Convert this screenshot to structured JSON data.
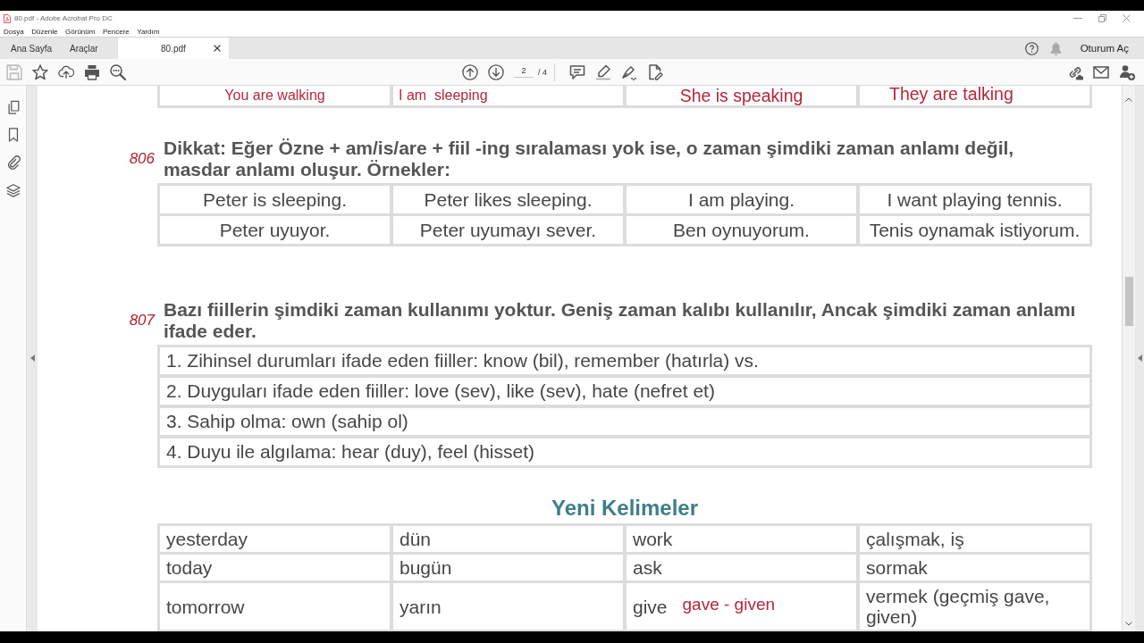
{
  "window": {
    "title": "80.pdf - Adobe Acrobat Pro DC"
  },
  "menu": [
    "Dosya",
    "Düzenle",
    "Görünüm",
    "Pencere",
    "Yardım"
  ],
  "tabs": [
    {
      "label": "Ana Sayfa",
      "selected": false,
      "closable": false
    },
    {
      "label": "Araçlar",
      "selected": false,
      "closable": false
    },
    {
      "label": "80.pdf",
      "selected": true,
      "closable": true
    }
  ],
  "account": {
    "label": "Oturum Aç"
  },
  "toolbar": {
    "save_disabled": true,
    "page": {
      "value": "2",
      "total": "/ 4"
    }
  },
  "document": {
    "top_row": [
      "You are walking",
      "I am  sleeping",
      "She is speaking",
      "They are talking"
    ],
    "sections": [
      {
        "number": "806",
        "heading": [
          "Dikkat: Eğer Özne + am/is/are + fiil -ing sıralaması yok ise, o zaman şimdiki zaman anlamı değil,",
          "masdar anlamı oluşur. Örnekler:"
        ],
        "kind": "grid",
        "rows": [
          [
            "Peter is sleeping.",
            "Peter likes sleeping.",
            "I am playing.",
            "I want playing tennis."
          ],
          [
            "Peter uyuyor.",
            "Peter uyumayı sever.",
            "Ben oynuyorum.",
            "Tenis oynamak istiyorum."
          ]
        ]
      },
      {
        "number": "807",
        "heading": [
          "Bazı fiillerin şimdiki zaman kullanımı yoktur. Geniş zaman kalıbı kullanılır, Ancak şimdiki zaman anlamı",
          "ifade eder."
        ],
        "kind": "list",
        "items": [
          "1. Zihinsel durumları ifade eden fiiller: know (bil), remember (hatırla) vs.",
          "2. Duyguları ifade eden fiiller: love (sev), like (sev), hate (nefret et)",
          "3. Sahip olma: own (sahip ol)",
          "4. Duyu ile algılama: hear (duy), feel (hisset)"
        ]
      }
    ],
    "vocabulary": {
      "title": "Yeni Kelimeler",
      "rows": [
        [
          {
            "text": "yesterday"
          },
          {
            "text": "dün"
          },
          {
            "text": "work"
          },
          {
            "text": "çalışmak, iş"
          }
        ],
        [
          {
            "text": "today"
          },
          {
            "text": "bugün"
          },
          {
            "text": "ask"
          },
          {
            "text": "sormak"
          }
        ],
        [
          {
            "text": "tomorrow"
          },
          {
            "text": "yarın"
          },
          {
            "text": "give",
            "note": "gave - given"
          },
          {
            "text": "vermek (geçmiş gave, given)"
          }
        ]
      ]
    }
  }
}
